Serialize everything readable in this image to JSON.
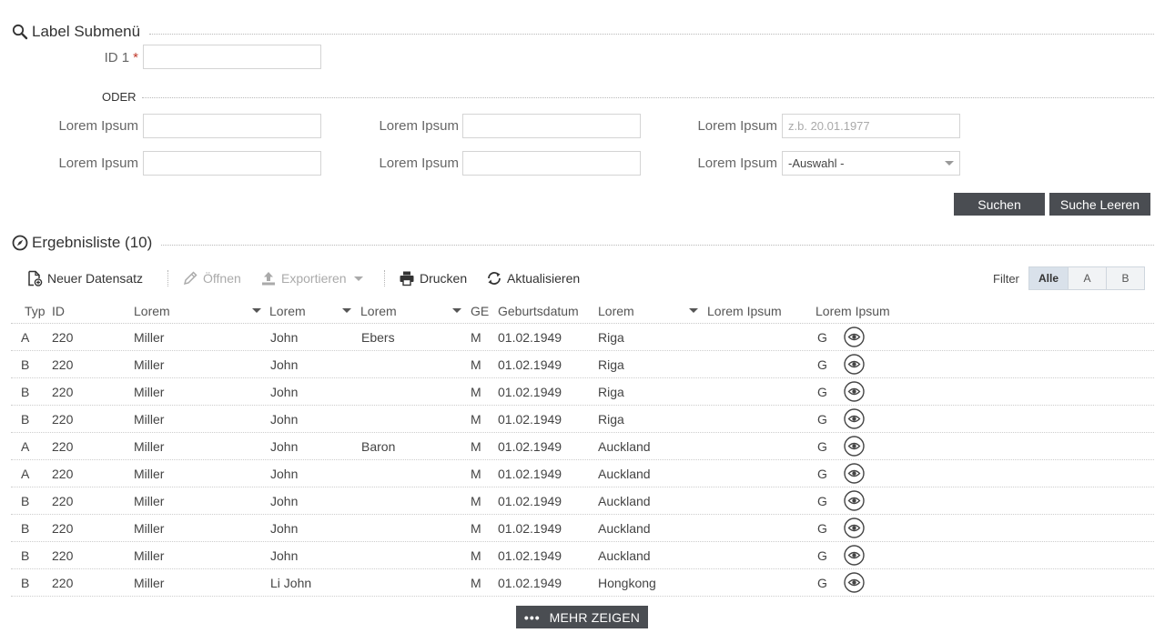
{
  "search_section": {
    "title": "Label Submenü",
    "id_label": "ID 1",
    "required_mark": "*",
    "id_value": "",
    "oder_label": "ODER",
    "fields": [
      {
        "label": "Lorem Ipsum",
        "value": "",
        "placeholder": ""
      },
      {
        "label": "Lorem Ipsum",
        "value": "",
        "placeholder": ""
      },
      {
        "label": "Lorem Ipsum",
        "value": "",
        "placeholder": "z.b. 20.01.1977"
      },
      {
        "label": "Lorem Ipsum",
        "value": "",
        "placeholder": ""
      },
      {
        "label": "Lorem Ipsum",
        "value": "",
        "placeholder": ""
      },
      {
        "label": "Lorem Ipsum",
        "selected": "-Auswahl -"
      }
    ],
    "search_button": "Suchen",
    "clear_button": "Suche Leeren"
  },
  "results_section": {
    "title": "Ergebnisliste (10)"
  },
  "toolbar": {
    "new_record": "Neuer Datensatz",
    "open": "Öffnen",
    "export": "Exportieren",
    "print": "Drucken",
    "refresh": "Aktualisieren",
    "filter_label": "Filter",
    "filter_options": [
      "Alle",
      "A",
      "B"
    ],
    "filter_active": "Alle"
  },
  "table": {
    "headers": [
      "Typ",
      "ID",
      "Lorem",
      "Lorem",
      "Lorem",
      "GE",
      "Geburtsdatum",
      "Lorem",
      "Lorem Ipsum",
      "Lorem Ipsum"
    ],
    "rows": [
      [
        "A",
        "220",
        "Miller",
        "John",
        "Ebers",
        "M",
        "01.02.1949",
        "Riga",
        "",
        "G"
      ],
      [
        "B",
        "220",
        "Miller",
        "John",
        "",
        "M",
        "01.02.1949",
        "Riga",
        "",
        "G"
      ],
      [
        "B",
        "220",
        "Miller",
        "John",
        "",
        "M",
        "01.02.1949",
        "Riga",
        "",
        "G"
      ],
      [
        "B",
        "220",
        "Miller",
        "John",
        "",
        "M",
        "01.02.1949",
        "Riga",
        "",
        "G"
      ],
      [
        "A",
        "220",
        "Miller",
        "John",
        "Baron",
        "M",
        "01.02.1949",
        "Auckland",
        "",
        "G"
      ],
      [
        "A",
        "220",
        "Miller",
        "John",
        "",
        "M",
        "01.02.1949",
        "Auckland",
        "",
        "G"
      ],
      [
        "B",
        "220",
        "Miller",
        "John",
        "",
        "M",
        "01.02.1949",
        "Auckland",
        "",
        "G"
      ],
      [
        "B",
        "220",
        "Miller",
        "John",
        "",
        "M",
        "01.02.1949",
        "Auckland",
        "",
        "G"
      ],
      [
        "B",
        "220",
        "Miller",
        "John",
        "",
        "M",
        "01.02.1949",
        "Auckland",
        "",
        "G"
      ],
      [
        "B",
        "220",
        "Miller",
        "Li John",
        "",
        "M",
        "01.02.1949",
        "Hongkong",
        "",
        "G"
      ]
    ]
  },
  "more_button": "MEHR ZEIGEN",
  "colors": {
    "dark_button": "#4a4d52",
    "required": "#c0392b",
    "filter_active_bg": "#d9e1ea"
  },
  "icons": [
    "search-icon",
    "compass-icon",
    "new-document-icon",
    "pencil-icon",
    "upload-icon",
    "printer-icon",
    "refresh-icon",
    "eye-icon",
    "dots-icon"
  ]
}
